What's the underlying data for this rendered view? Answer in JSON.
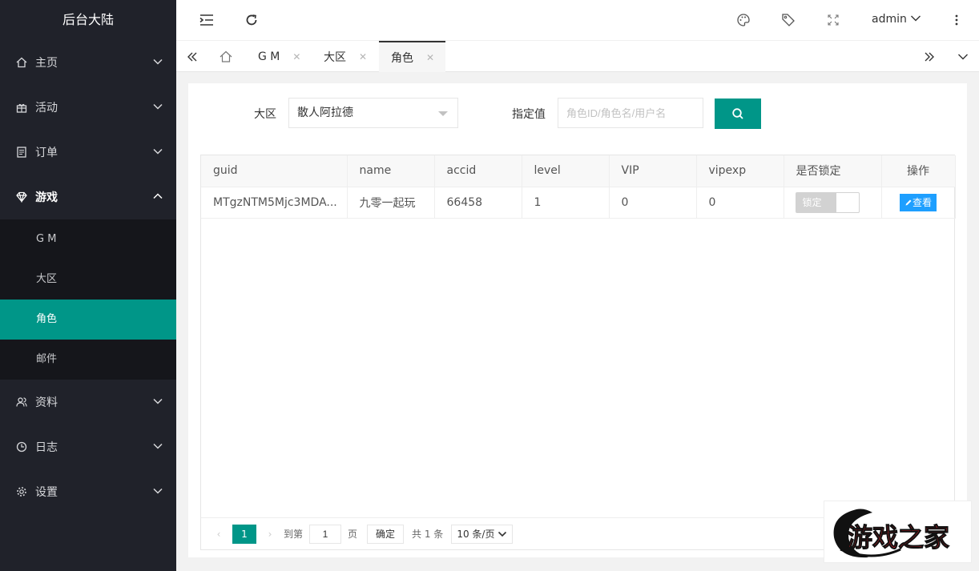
{
  "app": {
    "title": "后台大陆"
  },
  "sidebar": {
    "items": [
      {
        "label": "主页",
        "icon": "home-icon"
      },
      {
        "label": "活动",
        "icon": "gift-icon"
      },
      {
        "label": "订单",
        "icon": "document-icon"
      },
      {
        "label": "游戏",
        "icon": "diamond-icon"
      },
      {
        "label": "资料",
        "icon": "users-icon"
      },
      {
        "label": "日志",
        "icon": "clock-icon"
      },
      {
        "label": "设置",
        "icon": "gear-icon"
      }
    ],
    "game_sub": [
      {
        "label": "G M"
      },
      {
        "label": "大区"
      },
      {
        "label": "角色"
      },
      {
        "label": "邮件"
      }
    ]
  },
  "header": {
    "user": "admin"
  },
  "tabs": [
    {
      "label": "G M"
    },
    {
      "label": "大区"
    },
    {
      "label": "角色"
    }
  ],
  "filters": {
    "region_label": "大区",
    "region_value": "散人阿拉德",
    "search_label": "指定值",
    "search_placeholder": "角色ID/角色名/用户名"
  },
  "table": {
    "columns": [
      "guid",
      "name",
      "accid",
      "level",
      "VIP",
      "vipexp",
      "是否锁定",
      "操作"
    ],
    "rows": [
      {
        "guid": "MTgzNTM5Mjc3MDA...",
        "name": "九零一起玩",
        "accid": "66458",
        "level": "1",
        "vip": "0",
        "vipexp": "0",
        "lock": "锁定",
        "action": "查看"
      }
    ]
  },
  "pager": {
    "current": "1",
    "goto_label": "到第",
    "goto_value": "1",
    "page_unit": "页",
    "confirm": "确定",
    "total": "共 1 条",
    "page_size": "10 条/页"
  },
  "colors": {
    "accent": "#009688",
    "sidebar": "#20222a",
    "blue": "#1e9fff"
  }
}
